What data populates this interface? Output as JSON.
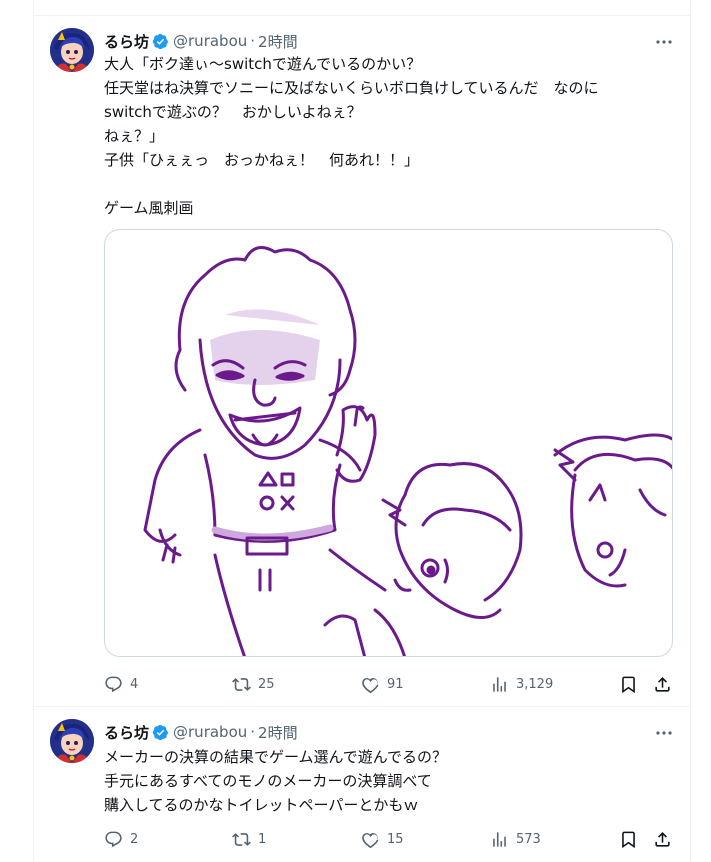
{
  "tweets": [
    {
      "name": "るら坊",
      "handle": "@rurabou",
      "separator": "·",
      "time": "2時間",
      "text": "大人「ボク達ぃ～switchで遊んでいるのかい？\n任天堂はね決算でソニーに及ばないくらいボロ負けしているんだ　なのに\nswitchで遊ぶの？　おかしいよねぇ？\nねぇ？」\n子供「ひぇぇっ　おっかねぇ！　何あれ！！」\n\nゲーム風刺画",
      "replies": "4",
      "retweets": "25",
      "likes": "91",
      "views": "3,129",
      "media_alt": "ゲーム風刺画"
    },
    {
      "name": "るら坊",
      "handle": "@rurabou",
      "separator": "·",
      "time": "2時間",
      "text": "メーカーの決算の結果でゲーム選んで遊んでるの？\n手元にあるすべてのモノのメーカーの決算調べて\n購入してるのかなトイレットペーパーとかもｗ",
      "replies": "2",
      "retweets": "1",
      "likes": "15",
      "views": "573"
    }
  ],
  "icons": [
    "verified-badge-icon",
    "more-icon",
    "reply-icon",
    "retweet-icon",
    "like-icon",
    "views-icon",
    "bookmark-icon",
    "share-icon"
  ],
  "colors": {
    "verified": "#1d9bf0",
    "secondary_text": "#536471",
    "drawing_stroke": "#6b1a8c"
  }
}
